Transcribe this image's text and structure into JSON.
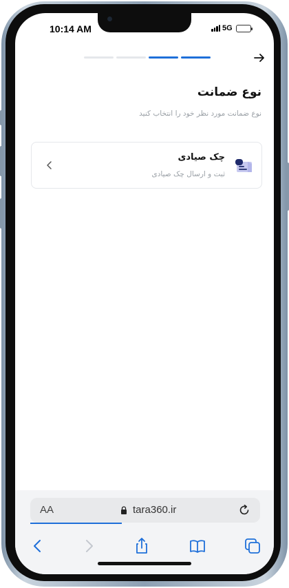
{
  "status_bar": {
    "time": "10:14 AM",
    "network": "5G"
  },
  "stepper": {
    "steps": [
      {
        "state": "inactive",
        "color": "#e5e7eb"
      },
      {
        "state": "inactive",
        "color": "#e5e7eb"
      },
      {
        "state": "active",
        "color": "#1e6fd9"
      },
      {
        "state": "active",
        "color": "#1e6fd9"
      }
    ]
  },
  "header": {
    "back_icon": "arrow-right-icon",
    "title": "نوع ضمانت",
    "subtitle": "نوع ضمانت مورد نظر خود را انتخاب کنید"
  },
  "options": [
    {
      "title": "چک صیادی",
      "description": "ثبت و ارسال چک صیادی",
      "icon": "cheque-icon",
      "chevron": "chevron-left-icon"
    }
  ],
  "browser": {
    "aa_label": "AA",
    "url": "tara360.ir",
    "lock_icon": "lock-icon",
    "reload_icon": "reload-icon",
    "toolbar": [
      "back-icon",
      "forward-icon",
      "share-icon",
      "bookmarks-icon",
      "tabs-icon"
    ]
  },
  "colors": {
    "accent": "#1e6fd9",
    "icon_navy": "#1f2a6b",
    "icon_lavender": "#c7c9f0"
  }
}
